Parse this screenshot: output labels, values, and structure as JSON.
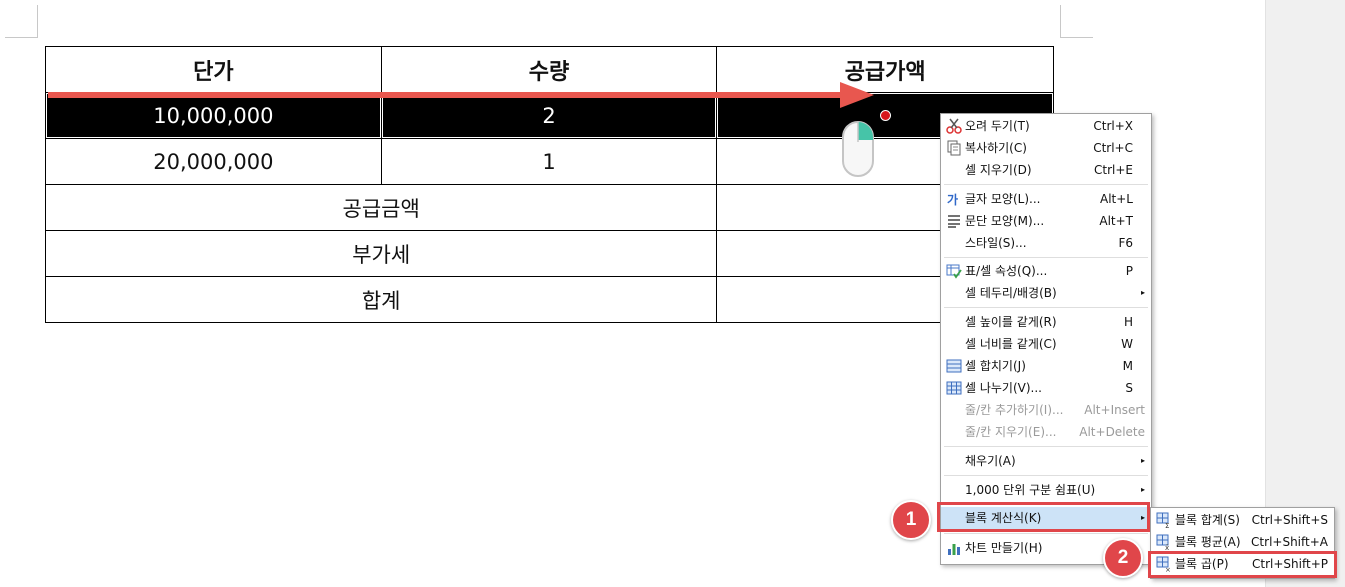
{
  "table": {
    "header": [
      "단가",
      "수량",
      "공급가액"
    ],
    "rows": [
      [
        "10,000,000",
        "2",
        ""
      ],
      [
        "20,000,000",
        "1",
        ""
      ]
    ],
    "summary_rows": [
      {
        "label": "공급금액",
        "value": ""
      },
      {
        "label": "부가세",
        "value": ""
      },
      {
        "label": "합계",
        "value": ""
      }
    ]
  },
  "context_menu": {
    "items": [
      {
        "label": "오려 두기(T)",
        "shortcut": "Ctrl+X",
        "icon": "scissors-icon"
      },
      {
        "label": "복사하기(C)",
        "shortcut": "Ctrl+C",
        "icon": "copy-icon"
      },
      {
        "label": "셀 지우기(D)",
        "shortcut": "Ctrl+E"
      },
      {
        "label": "글자 모양(L)...",
        "shortcut": "Alt+L",
        "icon": "font-shape-icon"
      },
      {
        "label": "문단 모양(M)...",
        "shortcut": "Alt+T",
        "icon": "paragraph-icon"
      },
      {
        "label": "스타일(S)...",
        "shortcut": "F6"
      },
      {
        "label": "표/셀 속성(Q)...",
        "shortcut": "P",
        "icon": "table-properties-icon"
      },
      {
        "label": "셀 테두리/배경(B)",
        "shortcut": ""
      },
      {
        "label": "셀 높이를 같게(R)",
        "shortcut": "H"
      },
      {
        "label": "셀 너비를 같게(C)",
        "shortcut": "W"
      },
      {
        "label": "셀 합치기(J)",
        "shortcut": "M",
        "icon": "merge-cells-icon"
      },
      {
        "label": "셀 나누기(V)...",
        "shortcut": "S",
        "icon": "split-cells-icon"
      },
      {
        "label": "줄/칸 추가하기(I)...",
        "shortcut": "Alt+Insert"
      },
      {
        "label": "줄/칸 지우기(E)...",
        "shortcut": "Alt+Delete"
      },
      {
        "label": "채우기(A)",
        "shortcut": ""
      },
      {
        "label": "1,000 단위 구분 쉼표(U)",
        "shortcut": ""
      },
      {
        "label": "블록 계산식(K)",
        "shortcut": ""
      },
      {
        "label": "차트 만들기(H)",
        "shortcut": "",
        "icon": "chart-icon"
      }
    ]
  },
  "submenu": {
    "items": [
      {
        "label": "블록 합계(S)",
        "shortcut": "Ctrl+Shift+S",
        "icon": "block-sum-icon"
      },
      {
        "label": "블록 평균(A)",
        "shortcut": "Ctrl+Shift+A",
        "icon": "block-average-icon"
      },
      {
        "label": "블록 곱(P)",
        "shortcut": "Ctrl+Shift+P",
        "icon": "block-product-icon"
      }
    ]
  },
  "annotations": {
    "step1": "1",
    "step2": "2"
  },
  "colors": {
    "highlight": "#cde3f7",
    "annotation": "#e0464a",
    "selected_row": "#000000"
  }
}
